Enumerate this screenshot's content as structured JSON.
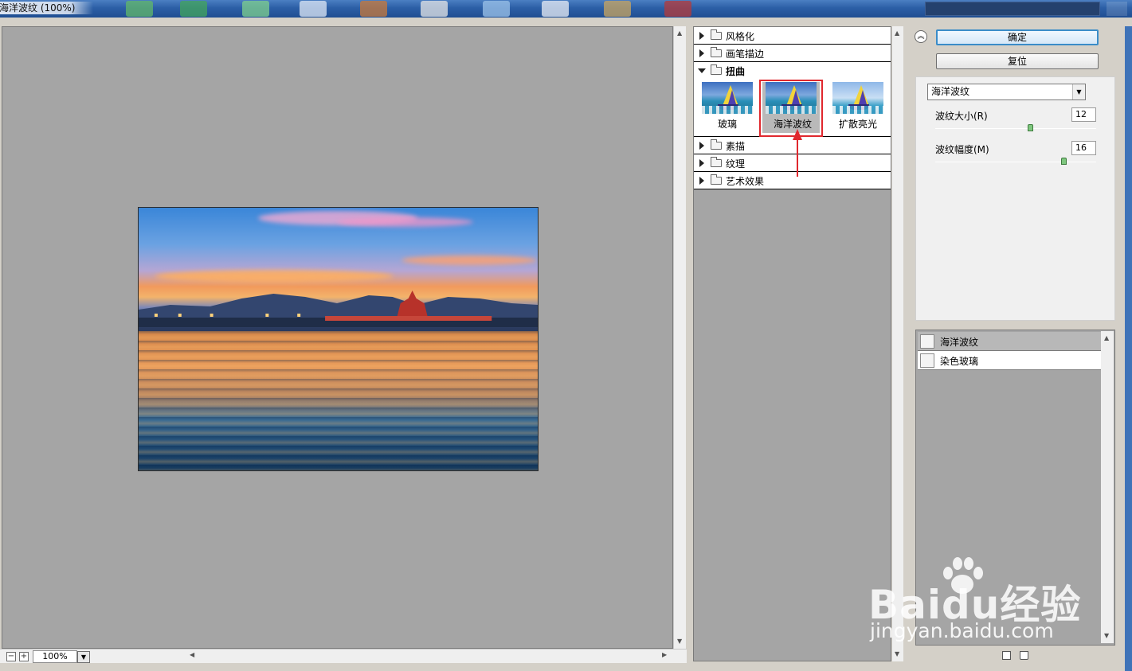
{
  "window": {
    "title": "海洋波纹 (100%)"
  },
  "preview": {
    "zoom": "100%"
  },
  "gallery": {
    "categories": [
      {
        "label": "风格化",
        "expanded": false
      },
      {
        "label": "画笔描边",
        "expanded": false
      },
      {
        "label": "扭曲",
        "expanded": true
      },
      {
        "label": "素描",
        "expanded": false
      },
      {
        "label": "纹理",
        "expanded": false
      },
      {
        "label": "艺术效果",
        "expanded": false
      }
    ],
    "distort_filters": [
      {
        "label": "玻璃",
        "selected": false
      },
      {
        "label": "海洋波纹",
        "selected": true
      },
      {
        "label": "扩散亮光",
        "selected": false
      }
    ]
  },
  "buttons": {
    "ok": "确定",
    "reset": "复位"
  },
  "settings": {
    "filter_select": "海洋波纹",
    "params": [
      {
        "label": "波纹大小(R)",
        "value": "12"
      },
      {
        "label": "波纹幅度(M)",
        "value": "16"
      }
    ]
  },
  "layers": [
    {
      "name": "海洋波纹",
      "active": true
    },
    {
      "name": "染色玻璃",
      "active": false
    }
  ],
  "watermark": {
    "brand": "Baidu经验",
    "url": "jingyan.baidu.com"
  },
  "colors": {
    "highlight": "#e0282e",
    "default_button_border": "#3a8cc8",
    "panel_gray": "#a5a5a5"
  }
}
